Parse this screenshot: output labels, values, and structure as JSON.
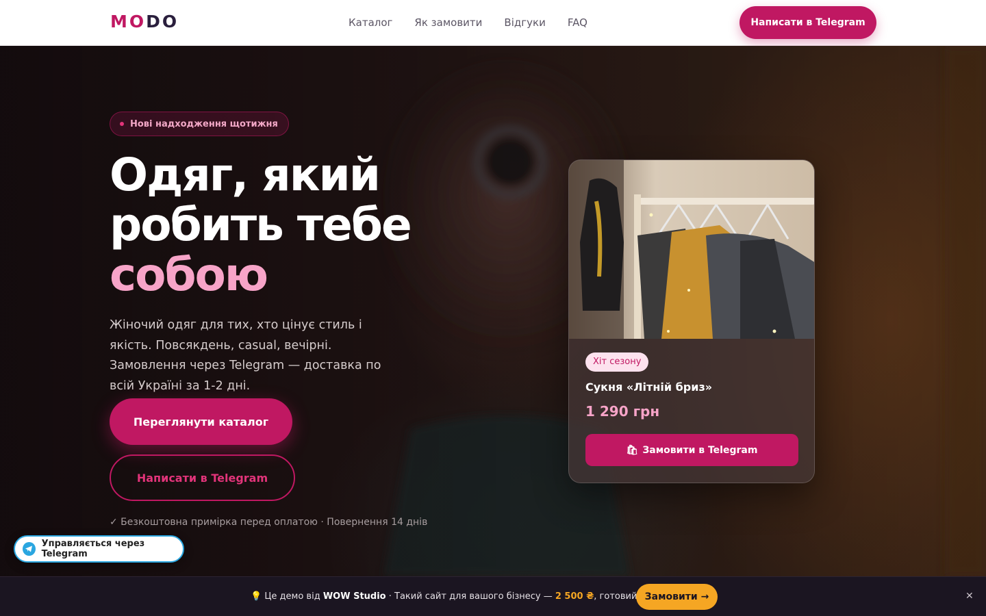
{
  "header": {
    "logo_accent": "MO",
    "logo_rest": "DO",
    "nav": [
      "Каталог",
      "Як замовити",
      "Відгуки",
      "FAQ"
    ],
    "cta": "Написати в Telegram"
  },
  "hero": {
    "badge": "Нові надходження щотижня",
    "title_line1": "Одяг, який",
    "title_line2": "робить тебе",
    "title_accent": "собою",
    "subtitle": "Жіночий одяг для тих, хто цінує стиль і якість. Повсякдень, casual, вечірні. Замовлення через Telegram — доставка по всій Україні за 1-2 дні.",
    "primary_button": "Переглянути каталог",
    "secondary_button": "Написати в Telegram",
    "note": "✓  Безкоштовна примірка перед оплатою · Повернення 14 днів"
  },
  "product_card": {
    "tag": "Хіт сезону",
    "name": "Сукня «Літній бриз»",
    "price": "1 290 грн",
    "order_button": "Замовити в Telegram"
  },
  "telegram_chip": {
    "label": "Управляється через Telegram"
  },
  "bottom_bar": {
    "prefix": "Це демо від ",
    "brand": "WOW Studio",
    "middle": " · Такий сайт для вашого бізнесу — ",
    "price": "2 500 ₴",
    "suffix": ", готовий за 3 дні",
    "button": "Замовити →",
    "close": "✕"
  },
  "colors": {
    "accent": "#c01862",
    "accent_light": "#f7a4c8",
    "gold": "#f5a623",
    "telegram": "#2aa6e0"
  }
}
